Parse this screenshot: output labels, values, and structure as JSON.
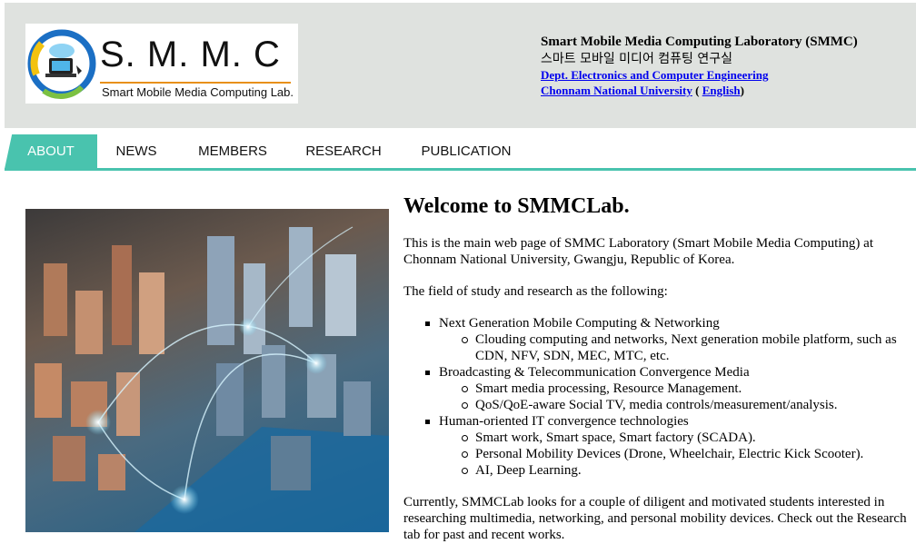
{
  "logo": {
    "wordmark": "S. M. M. C",
    "subtitle": "Smart Mobile Media Computing Lab."
  },
  "lab": {
    "name_en": "Smart Mobile Media Computing Laboratory (SMMC)",
    "name_ko": "스마트 모바일 미디어 컴퓨팅 연구실",
    "dept_link": "Dept. Electronics and Computer Engineering",
    "univ_link": "Chonnam National University",
    "open_paren": " ( ",
    "english_link": "English",
    "close_paren": ")"
  },
  "nav": {
    "tabs": [
      {
        "label": "ABOUT",
        "active": true
      },
      {
        "label": "NEWS"
      },
      {
        "label": "MEMBERS"
      },
      {
        "label": "RESEARCH"
      },
      {
        "label": "PUBLICATION"
      }
    ]
  },
  "colors": {
    "accent": "#49c3ae",
    "header_bg": "#dfe2df",
    "link": "#0000ee"
  },
  "main": {
    "heading": "Welcome to SMMCLab.",
    "intro": "This is the main web page of SMMC Laboratory (Smart Mobile Media Computing) at Chonnam National University, Gwangju, Republic of Korea.",
    "field_intro": "The field of study and research as the following:",
    "topics": [
      {
        "title": "Next Generation Mobile Computing & Networking",
        "items": [
          "Clouding computing and networks, Next generation mobile platform, such as CDN, NFV, SDN, MEC, MTC, etc."
        ]
      },
      {
        "title": "Broadcasting & Telecommunication Convergence Media",
        "items": [
          "Smart media processing, Resource Management.",
          "QoS/QoE-aware Social TV, media controls/measurement/analysis."
        ]
      },
      {
        "title": "Human-oriented IT convergence technologies",
        "items": [
          "Smart work, Smart space, Smart factory (SCADA).",
          "Personal Mobility Devices (Drone, Wheelchair, Electric Kick Scooter).",
          "AI, Deep Learning."
        ]
      }
    ],
    "closing": "Currently, SMMCLab looks for a couple of diligent and motivated students interested in researching multimedia, networking, and personal mobility devices. Check out the Research tab for past and recent works."
  }
}
